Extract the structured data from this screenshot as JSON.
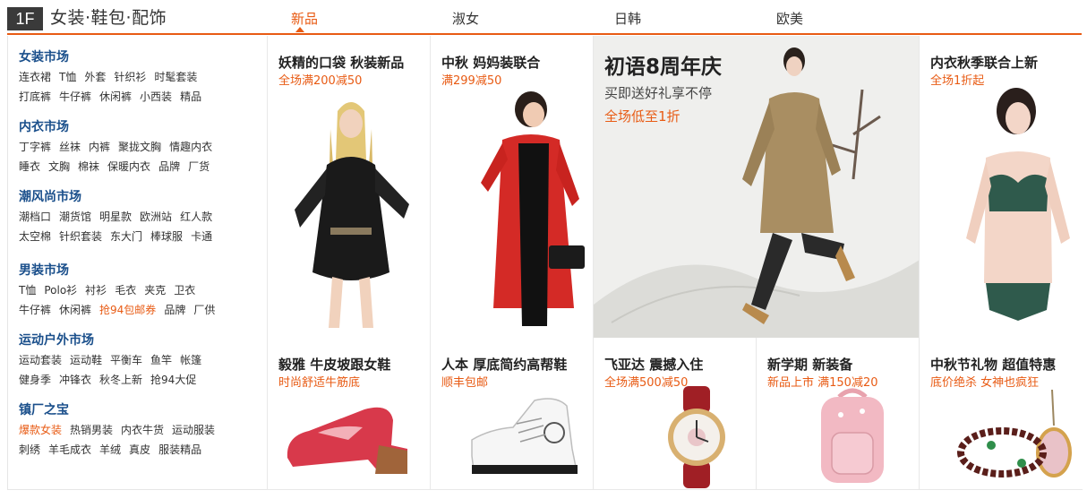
{
  "floor": {
    "badge": "1F",
    "title": "女装·鞋包·配饰"
  },
  "tabs": [
    {
      "label": "新品",
      "active": true
    },
    {
      "label": "淑女",
      "active": false
    },
    {
      "label": "日韩",
      "active": false
    },
    {
      "label": "欧美",
      "active": false
    }
  ],
  "colors": {
    "accent": "#e85b14",
    "category_title": "#1a4f8b",
    "badge_bg": "#3a3a3a"
  },
  "sidebar": {
    "categories": [
      {
        "title": "女装市场",
        "rows": [
          [
            "连衣裙",
            "T恤",
            "外套",
            "针织衫",
            "时髦套装"
          ],
          [
            "打底裤",
            "牛仔裤",
            "休闲裤",
            "小西装",
            "精品"
          ]
        ]
      },
      {
        "title": "内衣市场",
        "rows": [
          [
            "丁字裤",
            "丝袜",
            "内裤",
            "聚拢文胸",
            "情趣内衣"
          ],
          [
            "睡衣",
            "文胸",
            "棉袜",
            "保暖内衣",
            "品牌",
            "厂货"
          ]
        ]
      },
      {
        "title": "潮风尚市场",
        "rows": [
          [
            "潮档口",
            "潮货馆",
            "明星款",
            "欧洲站",
            "红人款"
          ],
          [
            "太空棉",
            "针织套装",
            "东大门",
            "棒球服",
            "卡通"
          ]
        ]
      },
      {
        "title": "男装市场",
        "rows": [
          [
            "T恤",
            "Polo衫",
            "衬衫",
            "毛衣",
            "夹克",
            "卫衣"
          ],
          [
            "牛仔裤",
            "休闲裤",
            "抢94包邮券",
            "品牌",
            "厂供"
          ]
        ]
      },
      {
        "title": "运动户外市场",
        "rows": [
          [
            "运动套装",
            "运动鞋",
            "平衡车",
            "鱼竿",
            "帐篷"
          ],
          [
            "健身季",
            "冲锋衣",
            "秋冬上新",
            "抢94大促"
          ]
        ]
      },
      {
        "title": "镇厂之宝",
        "rows": [
          [
            "爆款女装",
            "热销男装",
            "内衣牛货",
            "运动服装"
          ],
          [
            "刺绣",
            "羊毛成衣",
            "羊绒",
            "真皮",
            "服装精品"
          ]
        ]
      }
    ],
    "highlighted": [
      "抢94包邮券",
      "爆款女装"
    ]
  },
  "products": [
    {
      "title": "妖精的口袋 秋装新品",
      "subtitle": "全场满200减50",
      "icon": "black-dress-model-image"
    },
    {
      "title": "中秋 妈妈装联合",
      "subtitle": "满299减50",
      "icon": "red-coat-model-image"
    },
    {
      "title": "内衣秋季联合上新",
      "subtitle": "全场1折起",
      "icon": "lingerie-model-image"
    },
    {
      "title": "毅雅 牛皮坡跟女鞋",
      "subtitle": "时尚舒适牛筋底",
      "icon": "red-wedge-shoe-image"
    },
    {
      "title": "人本 厚底简约高帮鞋",
      "subtitle": "顺丰包邮",
      "icon": "white-sneaker-image"
    },
    {
      "title": "飞亚达 震撼入住",
      "subtitle": "全场满500减50",
      "icon": "wrist-watch-image"
    },
    {
      "title": "新学期 新装备",
      "subtitle": "新品上市 满150减20",
      "icon": "pink-backpack-image"
    },
    {
      "title": "中秋节礼物 超值特惠",
      "subtitle": "底价绝杀 女神也疯狂",
      "icon": "bead-bracelet-image"
    }
  ],
  "featured": {
    "title": "初语8周年庆",
    "subtitle": "买即送好礼享不停",
    "promo": "全场低至1折",
    "icon": "trench-coat-model-image"
  }
}
